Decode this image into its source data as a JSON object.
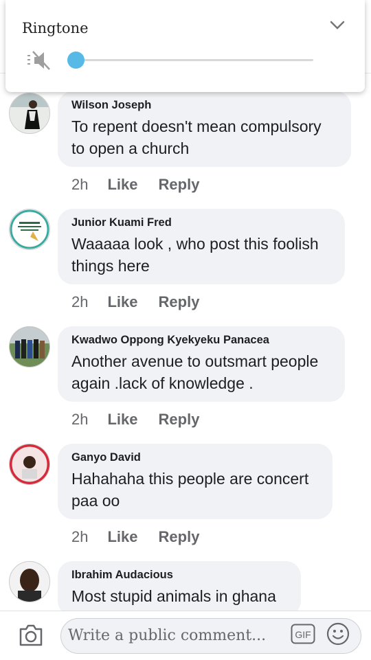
{
  "volume": {
    "title": "Ringtone",
    "level": 0.0,
    "icons": {
      "mute": "volume-muted-icon",
      "expand": "chevron-down-icon"
    },
    "accent": "#56b9e6"
  },
  "comments": [
    {
      "author": "Wilson Joseph",
      "text": "To repent doesn't mean compulsory to open a church",
      "time": "2h",
      "like": "Like",
      "reply": "Reply"
    },
    {
      "author": "Junior Kuami Fred",
      "text": "Waaaaa look , who post this foolish things here",
      "time": "2h",
      "like": "Like",
      "reply": "Reply"
    },
    {
      "author": "Kwadwo Oppong Kyekyeku Panacea",
      "text": "Another avenue to outsmart people again .lack of knowledge .",
      "time": "2h",
      "like": "Like",
      "reply": "Reply"
    },
    {
      "author": "Ganyo David",
      "text": "Hahahaha this people are concert paa oo",
      "time": "2h",
      "like": "Like",
      "reply": "Reply"
    },
    {
      "author": "Ibrahim Audacious",
      "text": "Most stupid animals in ghana",
      "time": "",
      "like": "",
      "reply": ""
    }
  ],
  "composer": {
    "placeholder": "Write a public comment...",
    "gif_label": "GIF",
    "icons": {
      "camera": "camera-icon",
      "emoji": "emoji-icon"
    }
  }
}
